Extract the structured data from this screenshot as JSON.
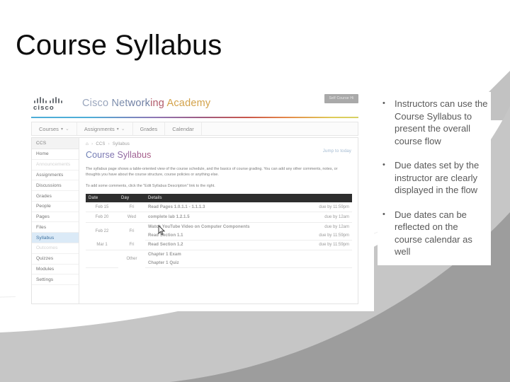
{
  "slide": {
    "title": "Course Syllabus",
    "title_color": "#0d0d0d",
    "background": "#ffffff"
  },
  "bullets": {
    "marker": "•",
    "items": [
      "Instructors can use the Course Syllabus to present the overall course flow",
      "Due dates set by the instructor are clearly displayed in the flow",
      "Due dates can be reflected on the course calendar as well"
    ]
  },
  "screenshot": {
    "brand": {
      "logo_text": "cisco",
      "title_parts": [
        {
          "text": "Cisco ",
          "color": "#9aa6bd"
        },
        {
          "text": "Net",
          "color": "#7e8fae"
        },
        {
          "text": "work",
          "color": "#6f7fa3"
        },
        {
          "text": "ing ",
          "color": "#b05a6a"
        },
        {
          "text": "Academy",
          "color": "#d3a24a"
        }
      ]
    },
    "top_button_label": "Self Course Hi",
    "nav": [
      {
        "label": "Courses",
        "caret": "▾",
        "chevron": "⌄"
      },
      {
        "label": "Assignments",
        "caret": "▾",
        "chevron": "⌄"
      },
      {
        "label": "Grades",
        "caret": "",
        "chevron": ""
      },
      {
        "label": "Calendar",
        "caret": "",
        "chevron": ""
      }
    ],
    "sidebar": {
      "header": "CCS",
      "items": [
        {
          "label": "Home",
          "state": "normal"
        },
        {
          "label": "Announcements",
          "state": "dim"
        },
        {
          "label": "Assignments",
          "state": "normal"
        },
        {
          "label": "Discussions",
          "state": "normal"
        },
        {
          "label": "Grades",
          "state": "normal"
        },
        {
          "label": "People",
          "state": "normal"
        },
        {
          "label": "Pages",
          "state": "normal"
        },
        {
          "label": "Files",
          "state": "normal"
        },
        {
          "label": "Syllabus",
          "state": "active"
        },
        {
          "label": "Outcomes",
          "state": "dim"
        },
        {
          "label": "Quizzes",
          "state": "normal"
        },
        {
          "label": "Modules",
          "state": "normal"
        },
        {
          "label": "Settings",
          "state": "normal"
        }
      ]
    },
    "breadcrumb": {
      "home_icon": "⌂",
      "sep": "›",
      "items": [
        "CCS",
        "Syllabus"
      ]
    },
    "page_heading": "Course Syllabus",
    "jump_link": "Jump to today",
    "paragraphs": [
      "The syllabus page shows a table-oriented view of the course schedule, and the basics of course grading. You can add any other comments, notes, or thoughts you have about the course structure, course policies or anything else.",
      "To add some comments, click the \"Edit Syllabus Description\" link to the right."
    ],
    "table": {
      "columns": [
        "Date",
        "Day",
        "Details",
        ""
      ],
      "rows": [
        {
          "date": "Feb 15",
          "day": "Fri",
          "details": "Read Pages 1.0.1.1 - 1.1.1.3",
          "due": "due by 11:59pm"
        },
        {
          "date": "Feb 20",
          "day": "Wed",
          "details": "complete lab 1.2.1.5",
          "due": "due by 12am"
        },
        {
          "date": "Feb 22",
          "day": "Fri",
          "details": "Watch YouTube Video on Computer Components",
          "due": "due by 12am"
        },
        {
          "date": "",
          "day": "",
          "details": "Read Section 1.1",
          "due": "due by 11:59pm"
        },
        {
          "date": "Mar 1",
          "day": "Fri",
          "details": "Read Section 1.2",
          "due": "due by 11:59pm"
        },
        {
          "date": "",
          "day": "Other",
          "details": "Chapter 1 Exam",
          "due": ""
        },
        {
          "date": "",
          "day": "",
          "details": "Chapter 1 Quiz",
          "due": ""
        }
      ]
    }
  }
}
